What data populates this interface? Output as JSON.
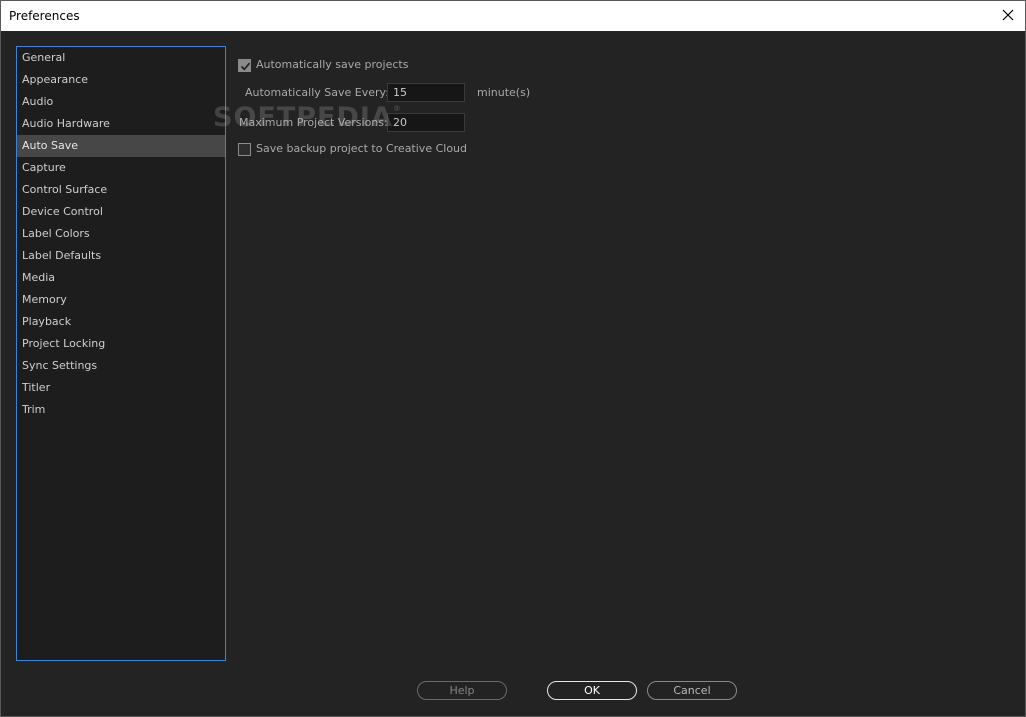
{
  "window": {
    "title": "Preferences"
  },
  "sidebar": {
    "items": [
      {
        "label": "General"
      },
      {
        "label": "Appearance"
      },
      {
        "label": "Audio"
      },
      {
        "label": "Audio Hardware"
      },
      {
        "label": "Auto Save"
      },
      {
        "label": "Capture"
      },
      {
        "label": "Control Surface"
      },
      {
        "label": "Device Control"
      },
      {
        "label": "Label Colors"
      },
      {
        "label": "Label Defaults"
      },
      {
        "label": "Media"
      },
      {
        "label": "Memory"
      },
      {
        "label": "Playback"
      },
      {
        "label": "Project Locking"
      },
      {
        "label": "Sync Settings"
      },
      {
        "label": "Titler"
      },
      {
        "label": "Trim"
      }
    ],
    "selected": "Auto Save"
  },
  "autosave": {
    "auto_save_label": "Automatically save projects",
    "auto_save_checked": true,
    "save_every_label": "Automatically Save Every:",
    "save_every_value": "15",
    "save_every_unit": "minute(s)",
    "max_versions_label": "Maximum Project Versions:",
    "max_versions_value": "20",
    "cloud_backup_label": "Save backup project to Creative Cloud",
    "cloud_backup_checked": false
  },
  "watermark": {
    "text": "SOFTPEDIA",
    "mark": "®"
  },
  "footer": {
    "help_label": "Help",
    "ok_label": "OK",
    "cancel_label": "Cancel"
  },
  "colors": {
    "background": "#232323",
    "selection": "#474747",
    "list_border": "#3d83d8"
  }
}
